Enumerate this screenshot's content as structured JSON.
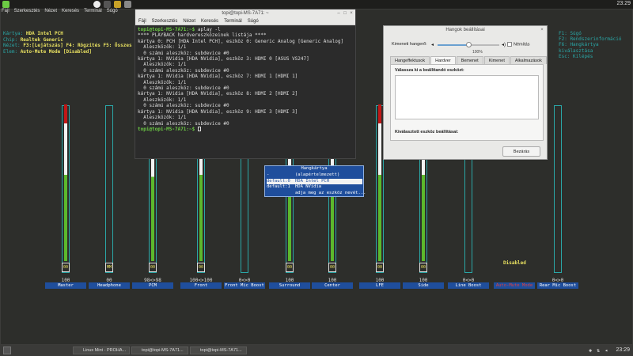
{
  "topbar": {
    "clock": "23:29"
  },
  "mixer": {
    "menu": [
      "Fájl",
      "Szerkesztés",
      "Nézet",
      "Keresés",
      "Terminál",
      "Súgó"
    ],
    "info": [
      {
        "key": "Kártya:",
        "value": "HDA Intel PCH"
      },
      {
        "key": "Chip:",
        "value": "Realtek Generic"
      },
      {
        "key": "Nézet:",
        "value": "F3:[Lejátszás] F4: Rögzítés F5: Összes"
      },
      {
        "key": "Elem:",
        "value": "Auto-Mute Mode [Disabled]"
      }
    ],
    "right_info": [
      "F1: Súgó",
      "F2: Rendszerinformáció",
      "F6: Hangkártya kiválasztása",
      "Esc: Kilépés"
    ],
    "channels": [
      {
        "name": "Master",
        "value": "100",
        "level": 1.0,
        "box": "00"
      },
      {
        "name": "Headphone",
        "value": "00",
        "level": 0.0,
        "box": "MM"
      },
      {
        "name": "PCM",
        "value": "98<>98",
        "level": 0.98,
        "box": "00"
      },
      {
        "name": "Front",
        "value": "100<>100",
        "level": 1.0,
        "box": "00"
      },
      {
        "name": "Front Mic Boost",
        "value": "0<>0",
        "level": 0.0,
        "box": ""
      },
      {
        "name": "Surround",
        "value": "100",
        "level": 1.0,
        "box": "00"
      },
      {
        "name": "Center",
        "value": "100",
        "level": 1.0,
        "box": "00"
      },
      {
        "name": "LFE",
        "value": "100",
        "level": 1.0,
        "box": "00"
      },
      {
        "name": "Side",
        "value": "100",
        "level": 1.0,
        "box": "00"
      },
      {
        "name": "Line Boost",
        "value": "0<>0",
        "level": 0.0,
        "box": ""
      },
      {
        "name": "Auto-Mute Mode",
        "value": "",
        "level": 0.0,
        "box": ""
      },
      {
        "name": "Rear Mic Boost",
        "value": "0<>0",
        "level": 0.0,
        "box": ""
      }
    ],
    "disabled_label": "Disabled"
  },
  "terminal": {
    "title": "topi@topi-MS-7A71: ~",
    "menu": [
      "Fájl",
      "Szerkesztés",
      "Nézet",
      "Keresés",
      "Terminál",
      "Súgó"
    ],
    "prompt": "topi@topi-MS-7A71:~$",
    "command": " aplay -l",
    "lines": [
      "**** PLAYBACK hardvereszközeinek listája ****",
      "kártya 0: PCH [HDA Intel PCH], eszköz 0: Generic Analog [Generic Analog]",
      "  Aleszközök: 1/1",
      "  0 számú aleszköz: subdevice #0",
      "kártya 1: NVidia [HDA NVidia], eszköz 3: HDMI 0 [ASUS VS247]",
      "  Aleszközök: 1/1",
      "  0 számú aleszköz: subdevice #0",
      "kártya 1: NVidia [HDA NVidia], eszköz 7: HDMI 1 [HDMI 1]",
      "  Aleszközök: 1/1",
      "  0 számú aleszköz: subdevice #0",
      "kártya 1: NVidia [HDA NVidia], eszköz 8: HDMI 2 [HDMI 2]",
      "  Aleszközök: 1/1",
      "  0 számú aleszköz: subdevice #0",
      "kártya 1: NVidia [HDA NVidia], eszköz 9: HDMI 3 [HDMI 3]",
      "  Aleszközök: 1/1",
      "  0 számú aleszköz: subdevice #0"
    ]
  },
  "sound": {
    "title": "Hangok beállításai",
    "volume_label": "Kimeneti hangerő:",
    "volume_pct": "100%",
    "volume_level": 1.0,
    "mute_label": "Némítás",
    "tabs": [
      "Hangeffektusok",
      "Hardver",
      "Bemenet",
      "Kimenet",
      "Alkalmazások"
    ],
    "active_tab": "Hardver",
    "device_heading": "Válassza ki a beállítandó eszközt:",
    "settings_heading": "Kiválasztott eszköz beállításai:",
    "close_label": "Bezárás"
  },
  "popup": {
    "title": "Hangkártya",
    "rows": [
      {
        "left": "-",
        "right": "(alapértelmezett)"
      },
      {
        "left": "default:0",
        "right": "HDA Intel PCH"
      },
      {
        "left": "default:1",
        "right": "HDA NVidia"
      },
      {
        "left": "",
        "right": "adja meg az eszköz nevét..."
      }
    ],
    "selected": 1
  },
  "taskbar": {
    "items": [
      "Linux Mint - PROHA...",
      "topi@topi-MS-7A71...",
      "topi@topi-MS-7A71..."
    ],
    "clock": "23:29"
  }
}
